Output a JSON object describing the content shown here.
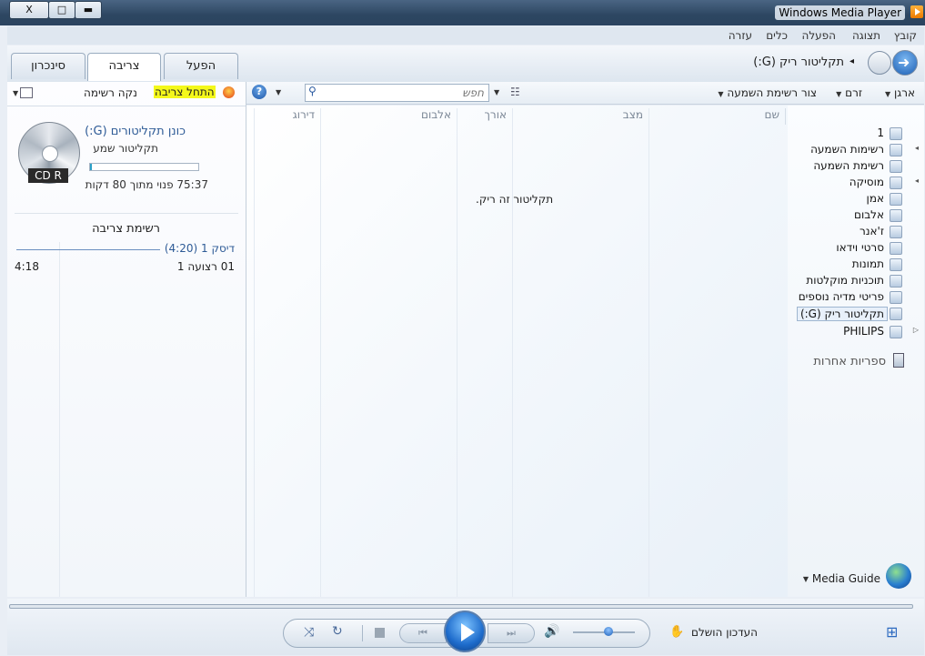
{
  "window": {
    "title": "Windows Media Player",
    "buttons": {
      "close": "X",
      "maximize": "□",
      "minimize": "▬"
    }
  },
  "menu": [
    "קובץ",
    "תצוגה",
    "הפעלה",
    "כלים",
    "עזרה"
  ],
  "nav": {
    "breadcrumb": "תקליטור ריק (G:)",
    "breadcrumb_arrow": "◂"
  },
  "tabs": {
    "play": "הפעל",
    "burn": "צריבה",
    "sync": "סינכרון"
  },
  "toolbar": {
    "organize": "ארגן",
    "stream": "זרם",
    "create_playlist": "צור רשימת השמעה",
    "search_placeholder": "חפש",
    "help": "?"
  },
  "burn_toolbar": {
    "start_burn": "התחל צריבה",
    "clear_list": "נקה רשימה"
  },
  "library_tree": [
    {
      "label": "1",
      "icon": "library-icon"
    },
    {
      "label": "רשימות השמעה",
      "icon": "playlist-icon",
      "expand": "◂"
    },
    {
      "label": "רשימת השמעה",
      "icon": "playlist-icon"
    },
    {
      "label": "מוסיקה",
      "icon": "music-note-icon",
      "expand": "◂"
    },
    {
      "label": "אמן",
      "icon": "artist-icon"
    },
    {
      "label": "אלבום",
      "icon": "album-icon"
    },
    {
      "label": "ז'אנר",
      "icon": "genre-icon"
    },
    {
      "label": "סרטי וידאו",
      "icon": "video-icon"
    },
    {
      "label": "תמונות",
      "icon": "pictures-icon"
    },
    {
      "label": "תוכניות מוקלטות",
      "icon": "recorded-tv-icon"
    },
    {
      "label": "פריטי מדיה נוספים",
      "icon": "other-media-icon"
    },
    {
      "label": "תקליטור ריק (G:)",
      "icon": "blank-disc-icon",
      "selected": true
    },
    {
      "label": "PHILIPS",
      "icon": "device-icon",
      "expand": "▷"
    }
  ],
  "other_libraries": "ספריות אחרות",
  "media_guide": "Media Guide",
  "columns": [
    "שם",
    "מצב",
    "אורך",
    "אלבום",
    "דירוג"
  ],
  "empty_message": "תקליטור זה ריק.",
  "drive": {
    "name": "כונן תקליטורים (G:)",
    "type": "תקליטור שמע",
    "disc_label": "CD R",
    "free_text": "75:37 פנוי מתוך 80 דקות",
    "progress_fraction": 0.02
  },
  "burn_list": {
    "title": "רשימת צריבה",
    "disc_header": "דיסק 1 (4:20)",
    "items": [
      {
        "title": "01 רצועה 1",
        "length": "4:18"
      }
    ]
  },
  "status": "העדכון הושלם",
  "colors": {
    "accent": "#1e6ccc",
    "highlight": "#f4f81a",
    "link": "#2d5a96"
  }
}
